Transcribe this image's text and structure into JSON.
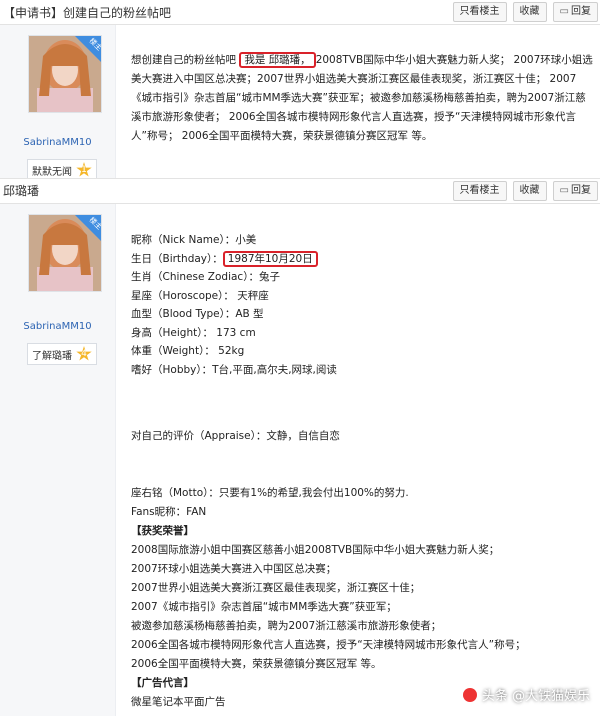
{
  "thread": {
    "title_tag": "【申请书】",
    "title_text": "创建自己的粉丝帖吧"
  },
  "actions": {
    "only_lz": "只看楼主",
    "collect": "收藏",
    "reply": "回复"
  },
  "post1": {
    "badge": "楼主",
    "username": "SabrinaMM10",
    "level_label": "默默无闻",
    "level_num": "1",
    "text_before": "想创建自己的粉丝帖吧  ",
    "text_highlight": "我是  邱璐璠，",
    "text_after": "2008TVB国际中华小姐大赛魅力新人奖；  2007环球小姐选美大赛进入中国区总决赛；2007世界小姐选美大赛浙江赛区最佳表现奖，浙江赛区十佳；  2007《城市指引》杂志首届“城市MM季选大赛”获亚军；被邀参加慈溪杨梅慈善拍卖，聘为2007浙江慈溪市旅游形象使者；  2006全国各城市模特网形象代言人直选赛，授予“天津模特网城市形象代言人”称号；  2006全国平面模特大赛，荣获景德镇分赛区冠军 等。"
  },
  "strip": {
    "name": "邱璐璠"
  },
  "post2": {
    "badge": "楼主",
    "username": "SabrinaMM10",
    "level_label": "了解璐璠",
    "level_num": "4",
    "profile": [
      "昵称（Nick Name）：小美",
      "生日（Birthday）：",
      "生肖（Chinese Zodiac）：兔子",
      "星座（Horoscope）：  天秤座",
      "血型（Blood Type）：AB 型",
      "身高（Height）：  173 cm",
      "体重（Weight）：  52kg",
      "嗜好（Hobby）：T台,平面,高尔夫,网球,阅读"
    ],
    "birthday_value": "1987年10月20日",
    "appraise": "对自己的评价（Appraise）：文静，自信自恋",
    "motto": "座右铭（Motto）：只要有1%的希望,我会付出100%的努力.",
    "fans": "Fans昵称：FAN",
    "honor_header": "【获奖荣誉】",
    "honors": [
      "2008国际旅游小姐中国赛区慈善小姐2008TVB国际中华小姐大赛魅力新人奖；",
      "2007环球小姐选美大赛进入中国区总决赛；",
      "2007世界小姐选美大赛浙江赛区最佳表现奖，浙江赛区十佳；",
      "2007《城市指引》杂志首届“城市MM季选大赛”获亚军；",
      "被邀参加慈溪杨梅慈善拍卖，聘为2007浙江慈溪市旅游形象使者；",
      "2006全国各城市模特网形象代言人直选赛，授予“天津模特网城市形象代言人”称号；",
      "2006全国平面模特大赛，荣获景德镇分赛区冠军 等。"
    ],
    "ad_header": "【广告代言】",
    "ads": [
      "微星笔记本平面广告"
    ]
  },
  "watermark": "头条 @大铁猫娱乐",
  "colors": {
    "highlight": "#d9222a",
    "username": "#2d64b3"
  }
}
